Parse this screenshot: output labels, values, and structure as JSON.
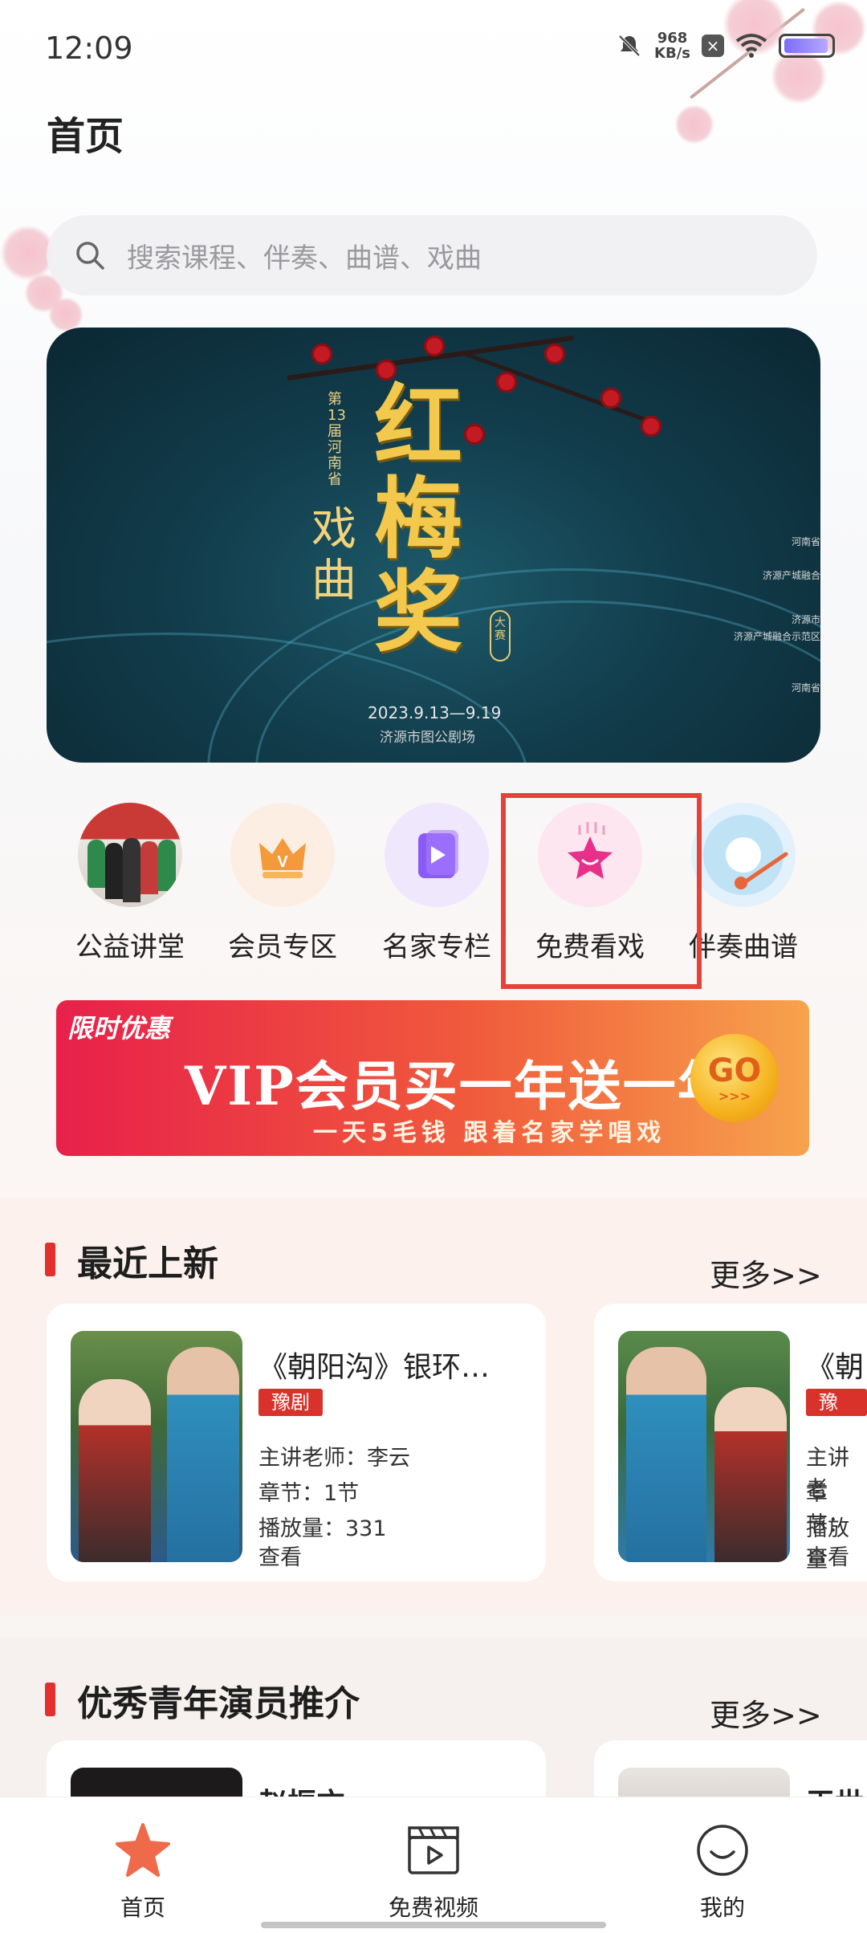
{
  "status_bar": {
    "time": "12:09",
    "speed_value": "968",
    "speed_unit": "KB/s"
  },
  "page_title": "首页",
  "search": {
    "placeholder": "搜索课程、伴奏、曲谱、戏曲"
  },
  "banner": {
    "title": "红梅奖",
    "subtitle": "戏曲",
    "edition": "第13届河南省",
    "tag": "大赛",
    "dates": "2023.9.13—9.19",
    "venue": "济源市图公剧场",
    "right_lines": [
      "河南省",
      "济源产城融合",
      "济源市",
      "济源产城融合示范区",
      "河南省"
    ]
  },
  "shortcuts": [
    {
      "label": "公益讲堂",
      "icon": "group-photo-icon"
    },
    {
      "label": "会员专区",
      "icon": "crown-icon"
    },
    {
      "label": "名家专栏",
      "icon": "play-book-icon"
    },
    {
      "label": "免费看戏",
      "icon": "star-smile-icon"
    },
    {
      "label": "伴奏曲谱",
      "icon": "record-player-icon"
    }
  ],
  "vip_banner": {
    "tag": "限时优惠",
    "headline": "VIP会员买一年送一年",
    "sub": "一天5毛钱 跟着名家学唱戏",
    "go": "GO",
    "go_arrows": ">>>"
  },
  "recent": {
    "title": "最近上新",
    "more": "更多>>",
    "cards": [
      {
        "title": "《朝阳沟》银环…",
        "badge": "豫剧",
        "teacher": "主讲老师：李云",
        "chapters": "章节：1节",
        "plays": "播放量：331",
        "action": "查看"
      },
      {
        "title": "《朝",
        "badge": "豫剧",
        "teacher": "主讲老",
        "chapters": "章节：",
        "plays": "播放量",
        "action": "查看"
      }
    ]
  },
  "young": {
    "title": "优秀青年演员推介",
    "more": "更多>>",
    "cards": [
      {
        "name": "赵振方"
      },
      {
        "name": "王世"
      }
    ]
  },
  "nav": {
    "home": "首页",
    "videos": "免费视频",
    "mine": "我的"
  },
  "colors": {
    "accent": "#e2302e",
    "highlight": "#e2443b"
  }
}
